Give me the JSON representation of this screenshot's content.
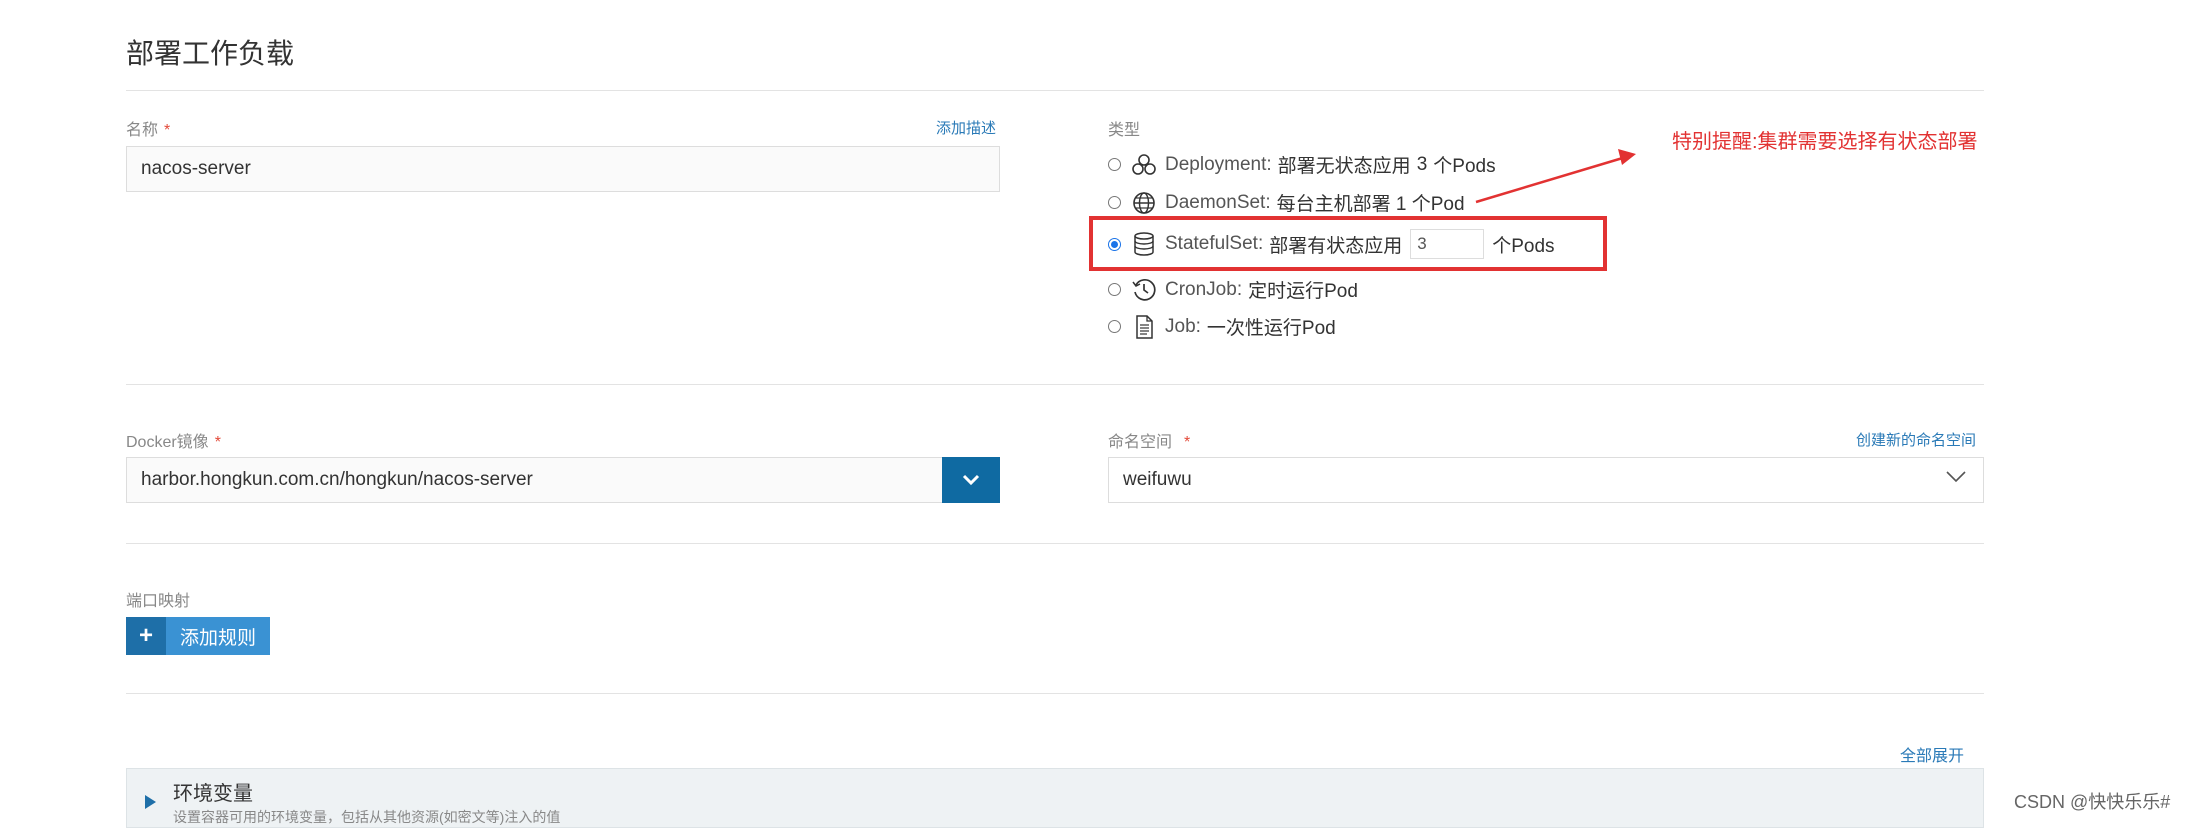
{
  "page": {
    "title": "部署工作负载"
  },
  "name_field": {
    "label": "名称",
    "required": "*",
    "value": "nacos-server",
    "add_description": "添加描述"
  },
  "type_field": {
    "label": "类型",
    "options": [
      {
        "name": "Deployment:",
        "desc": "部署无状态应用",
        "count": "3",
        "suffix": "个Pods",
        "selected": false
      },
      {
        "name": "DaemonSet:",
        "desc": "每台主机部署 1 个Pod",
        "selected": false
      },
      {
        "name": "StatefulSet:",
        "desc": "部署有状态应用",
        "count": "3",
        "suffix": "个Pods",
        "selected": true
      },
      {
        "name": "CronJob:",
        "desc": "定时运行Pod",
        "selected": false
      },
      {
        "name": "Job:",
        "desc": "一次性运行Pod",
        "selected": false
      }
    ]
  },
  "annotation": {
    "note": "特别提醒:集群需要选择有状态部署",
    "color": "#e23232"
  },
  "docker_image": {
    "label": "Docker镜像",
    "required": "*",
    "value": "harbor.hongkun.com.cn/hongkun/nacos-server"
  },
  "namespace": {
    "label": "命名空间",
    "required": "*",
    "value": "weifuwu",
    "create_link": "创建新的命名空间"
  },
  "port_mapping": {
    "label": "端口映射",
    "add_rule": "添加规则",
    "plus": "+"
  },
  "env": {
    "expand_all": "全部展开",
    "title": "环境变量",
    "desc": "设置容器可用的环境变量，包括从其他资源(如密文等)注入的值"
  },
  "watermark": "CSDN @快快乐乐#",
  "colors": {
    "primary": "#0f6aa2",
    "button": "#3a92d3",
    "link": "#2a7ab7",
    "required": "#e34a3a"
  }
}
